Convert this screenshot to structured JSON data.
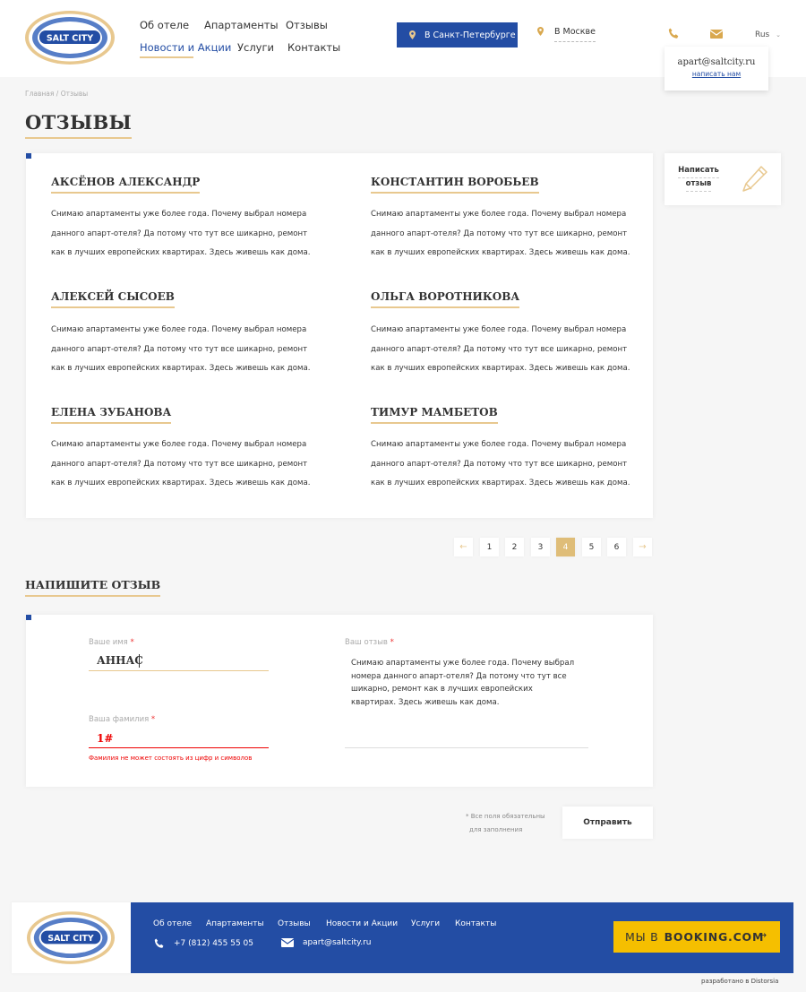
{
  "header": {
    "logo_text": "SALT CITY",
    "nav": [
      {
        "label": "Об отеле",
        "active": false
      },
      {
        "label": "Апартаменты",
        "active": false
      },
      {
        "label": "Отзывы",
        "active": false
      },
      {
        "label": "Новости и Акции",
        "active": true
      },
      {
        "label": "Услуги",
        "active": false
      },
      {
        "label": "Контакты",
        "active": false
      }
    ],
    "city_active": "В Санкт-Петербурге",
    "city_other": "В Москве",
    "lang": "Rus",
    "email_popup": {
      "email": "apart@saltcity.ru",
      "write_link": "написать нам"
    }
  },
  "breadcrumb": "Главная / Отзывы",
  "page_title": "ОТЗЫВЫ",
  "reviews": [
    {
      "name": "АКСЁНОВ АЛЕКСАНДР",
      "text": "Снимаю апартаменты уже более года. Почему выбрал номера данного апарт-отеля? Да потому что тут все шикарно, ремонт как в лучших европейских квартирах. Здесь живешь как дома."
    },
    {
      "name": "КОНСТАНТИН ВОРОБЬЕВ",
      "text": "Снимаю апартаменты уже более года. Почему выбрал номера данного апарт-отеля? Да потому что тут все шикарно, ремонт как в лучших европейских квартирах. Здесь живешь как дома."
    },
    {
      "name": "АЛЕКСЕЙ СЫСОЕВ",
      "text": "Снимаю апартаменты уже более года. Почему выбрал номера данного апарт-отеля? Да потому что тут все шикарно, ремонт как в лучших европейских квартирах. Здесь живешь как дома."
    },
    {
      "name": "ОЛЬГА ВОРОТНИКОВА",
      "text": "Снимаю апартаменты уже более года. Почему выбрал номера данного апарт-отеля? Да потому что тут все шикарно, ремонт как в лучших европейских квартирах. Здесь живешь как дома."
    },
    {
      "name": "ЕЛЕНА ЗУБАНОВА",
      "text": "Снимаю апартаменты уже более года. Почему выбрал номера данного апарт-отеля? Да потому что тут все шикарно, ремонт как в лучших европейских квартирах. Здесь живешь как дома."
    },
    {
      "name": "ТИМУР МАМБЕТОВ",
      "text": "Снимаю апартаменты уже более года. Почему выбрал номера данного апарт-отеля? Да потому что тут все шикарно, ремонт как в лучших европейских квартирах. Здесь живешь как дома."
    }
  ],
  "write_review_button": "Написать отзыв",
  "pagination": {
    "prev": "←",
    "next": "→",
    "pages": [
      "1",
      "2",
      "3",
      "4",
      "5",
      "6"
    ],
    "current": "4"
  },
  "form": {
    "title": "НАПИШИТЕ ОТЗЫВ",
    "name_label": "Ваше имя",
    "name_value": "АННАС",
    "surname_label": "Ваша фамилия",
    "surname_value": "1#",
    "surname_error": "Фамилия не может состоять из цифр и символов",
    "review_label": "Ваш отзыв",
    "review_value": "Снимаю апартаменты уже более года. Почему выбрал номера данного апарт-отеля? Да потому что тут все шикарно, ремонт как в лучших европейских квартирах. Здесь живешь как дома.",
    "required_mark": "*",
    "required_note_1": "* Все поля обязательны",
    "required_note_2": "для заполнения",
    "submit": "Отправить"
  },
  "footer": {
    "nav": [
      "Об отеле",
      "Апартаменты",
      "Отзывы",
      "Новости и Акции",
      "Услуги",
      "Контакты"
    ],
    "phone": "+7 (812) 455 55 05",
    "email": "apart@saltcity.ru",
    "booking_prefix": "МЫ В",
    "booking_brand": "BOOKING.COM",
    "booking_arrow": "→",
    "developer": "разработано в Distorsia"
  },
  "colors": {
    "primary_blue": "#234da4",
    "gold": "#e8c88f",
    "booking_yellow": "#f5bf00",
    "error": "#e00000"
  }
}
